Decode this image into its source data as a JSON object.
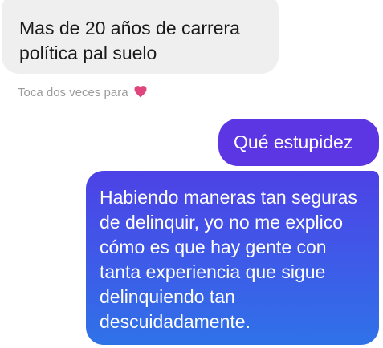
{
  "messages": {
    "received": {
      "text": "Mas de 20 años de carrera política pal suelo"
    },
    "hint": {
      "text": "Toca dos veces para",
      "icon": "heart-icon",
      "icon_color": "#e0457b"
    },
    "sent": [
      {
        "text": "Qué estupidez"
      },
      {
        "text": "Habiendo maneras tan seguras de delinquir, yo no me explico cómo es que hay gente con tanta experiencia que sigue delinquiendo tan descuidadamente."
      }
    ]
  },
  "colors": {
    "received_bubble": "#efefef",
    "sent_bubble_top": "#5b36e2",
    "sent_bubble_bottom": "#2f72e8",
    "hint_text": "#9a9a9a"
  }
}
